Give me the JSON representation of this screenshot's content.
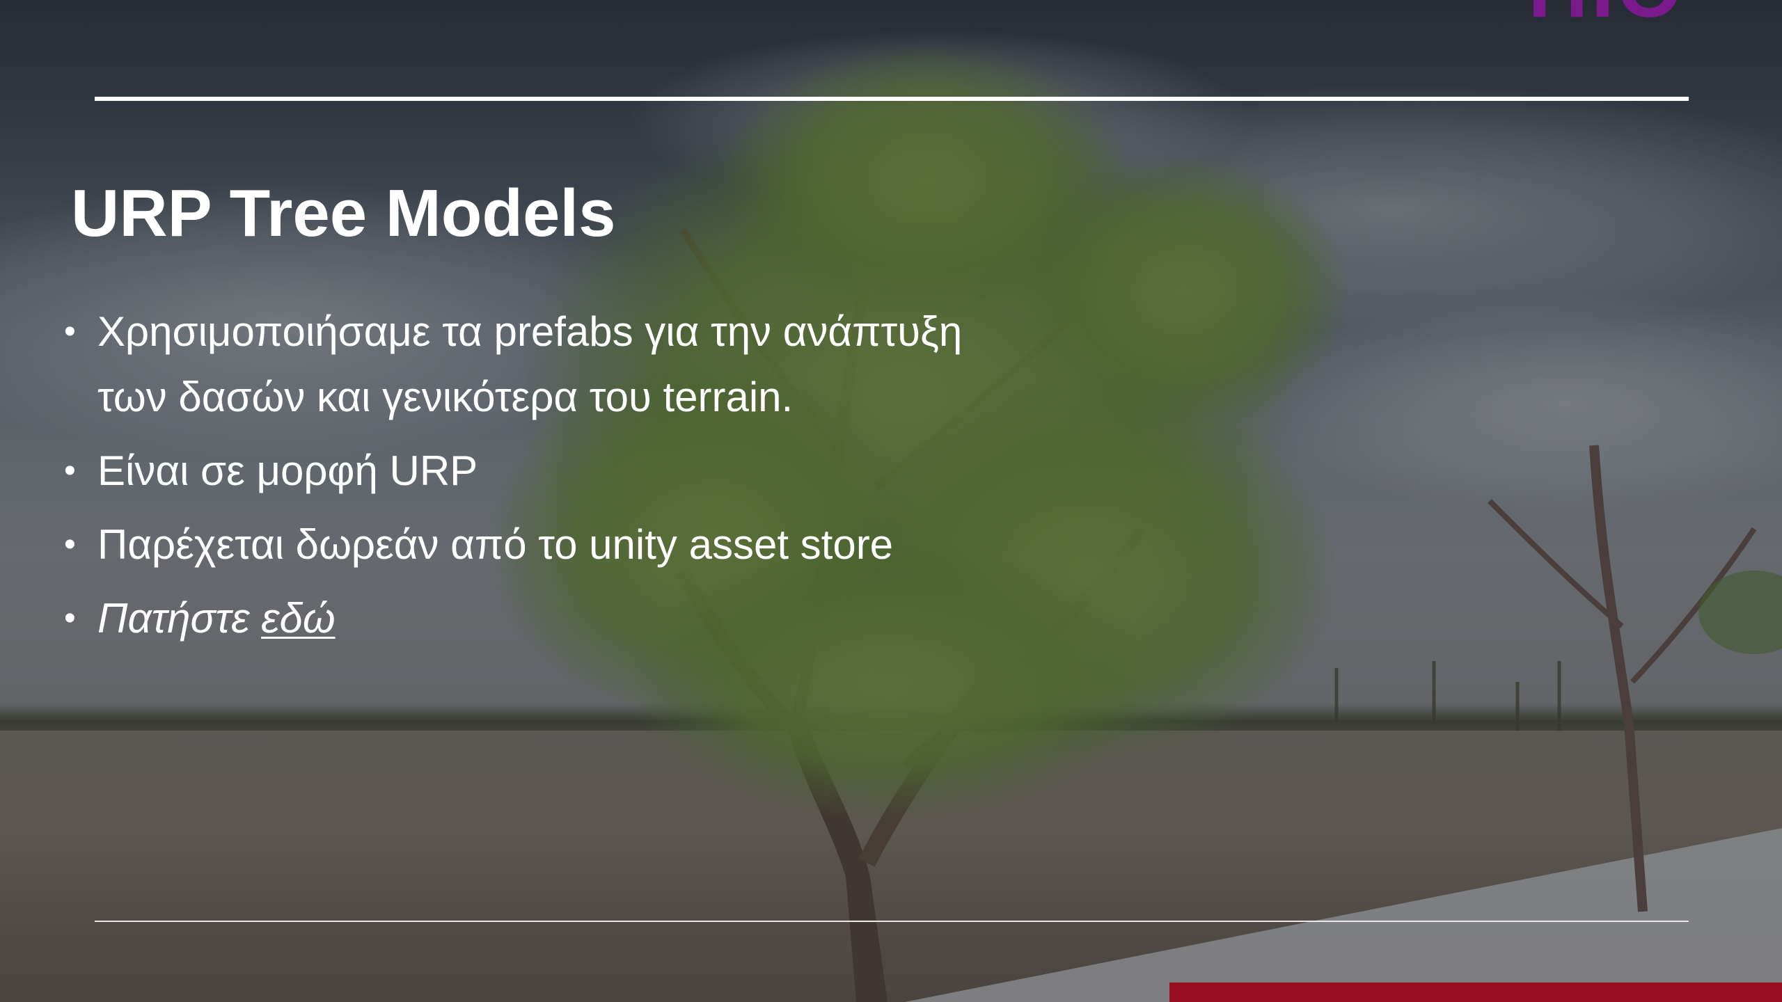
{
  "slide": {
    "title": "URP Tree Models",
    "corner_mark": "ΠΙΘ",
    "bullets": [
      {
        "text": "Χρησιμοποιήσαμε τα prefabs για την ανάπτυξη των δασών και γενικότερα του terrain."
      },
      {
        "text": "Είναι σε μορφή URP"
      },
      {
        "text": "Παρέχεται δωρεάν από το unity asset store"
      },
      {
        "text_prefix": "Πατήστε ",
        "link_text": "εδώ"
      }
    ],
    "bullet_glyph": "•"
  },
  "colors": {
    "accent_red": "#9a0e22",
    "corner_mark": "#7a1a8c"
  },
  "background": {
    "description_icon": "tree-photo"
  }
}
